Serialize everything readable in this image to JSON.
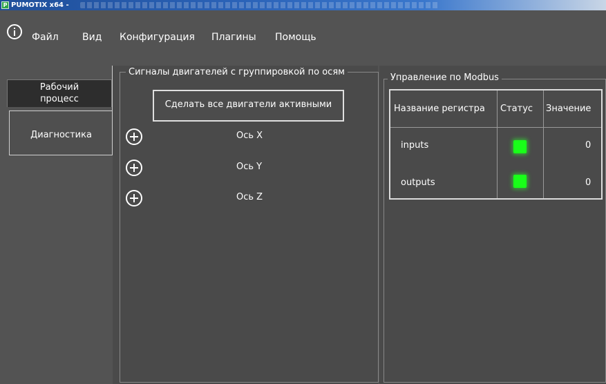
{
  "window": {
    "title": "PUMOTIX x64 -"
  },
  "menu": {
    "items": [
      "Файл",
      "Вид",
      "Конфигурация",
      "Плагины",
      "Помощь"
    ]
  },
  "nav": {
    "tabs": [
      {
        "label_line1": "Рабочий",
        "label_line2": "процесс",
        "active": false
      },
      {
        "label": "Диагностика",
        "active": true
      }
    ]
  },
  "motors_group": {
    "title": "Сигналы двигателей с группировкой по осям",
    "activate_button": "Сделать все двигатели активными",
    "axes": [
      {
        "label": "Ось X"
      },
      {
        "label": "Ось Y"
      },
      {
        "label": "Ось Z"
      }
    ]
  },
  "modbus_group": {
    "title": "Управление по Modbus",
    "columns": [
      "Название регистра",
      "Статус",
      "Значение"
    ],
    "rows": [
      {
        "name": "inputs",
        "status_color": "#19ff19",
        "value": "0"
      },
      {
        "name": "outputs",
        "status_color": "#19ff19",
        "value": "0"
      }
    ]
  },
  "colors": {
    "background": "#535353",
    "panel": "#4a4a4a",
    "status_ok": "#19ff19"
  }
}
